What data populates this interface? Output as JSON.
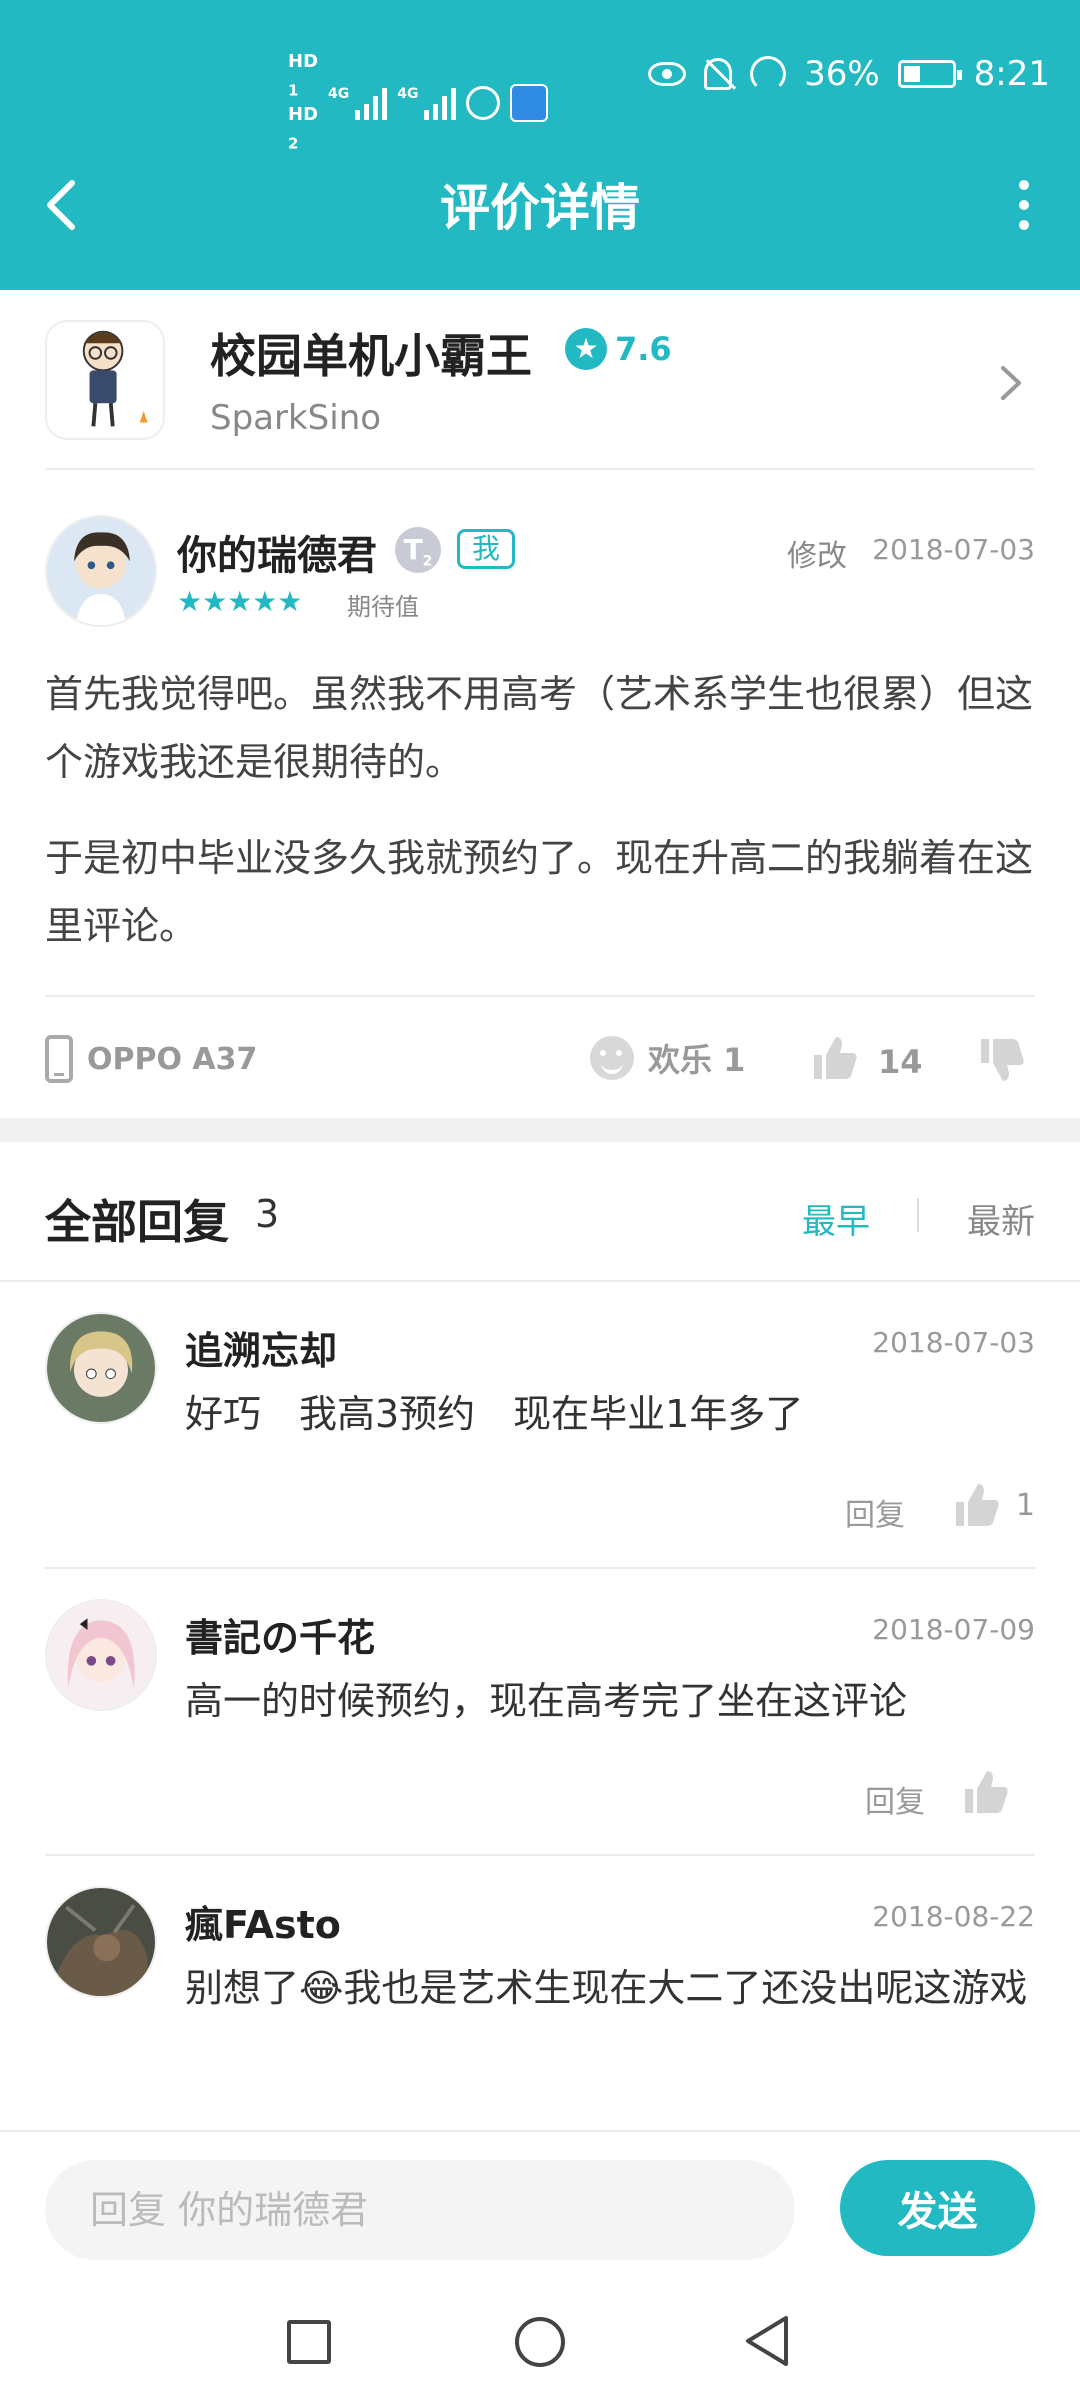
{
  "status_bar": {
    "hd1": "HD",
    "hd1_sub": "1",
    "hd2": "HD",
    "hd2_sub": "2",
    "net1": "4G",
    "net2": "4G",
    "battery": "36%",
    "time": "8:21"
  },
  "header": {
    "title": "评价详情",
    "back_icon": "chevron-left-icon",
    "more_icon": "more-vertical-icon",
    "color": "#22b9c3"
  },
  "app": {
    "name": "校园单机小霸王",
    "score": "7.6",
    "developer": "SparkSino"
  },
  "review": {
    "author": "你的瑞德君",
    "level_badge": "T",
    "level_sub": "2",
    "me_badge": "我",
    "edit_label": "修改",
    "date": "2018-07-03",
    "stars": "★★★★★",
    "expectation_label": "期待值",
    "paragraphs": [
      "首先我觉得吧。虽然我不用高考（艺术系学生也很累）但这个游戏我还是很期待的。",
      "于是初中毕业没多久我就预约了。现在升高二的我躺着在这里评论。"
    ],
    "device": "OPPO A37",
    "mood": "欢乐 1",
    "likes": "14"
  },
  "replies_header": {
    "title": "全部回复",
    "count": "3",
    "sort_early": "最早",
    "sort_new": "最新"
  },
  "replies": [
    {
      "name": "追溯忘却",
      "date": "2018-07-03",
      "text": "好巧　我高3预约　现在毕业1年多了",
      "reply_label": "回复",
      "likes": "1"
    },
    {
      "name": "書記の千花",
      "date": "2018-07-09",
      "text": "高一的时候预约，现在高考完了坐在这评论",
      "reply_label": "回复",
      "likes": ""
    },
    {
      "name": "瘋FAsto",
      "date": "2018-08-22",
      "text": "别想了😂我也是艺术生现在大二了还没出呢这游戏",
      "reply_label": "",
      "likes": ""
    }
  ],
  "reply_bar": {
    "placeholder": "回复 你的瑞德君",
    "send_label": "发送"
  }
}
